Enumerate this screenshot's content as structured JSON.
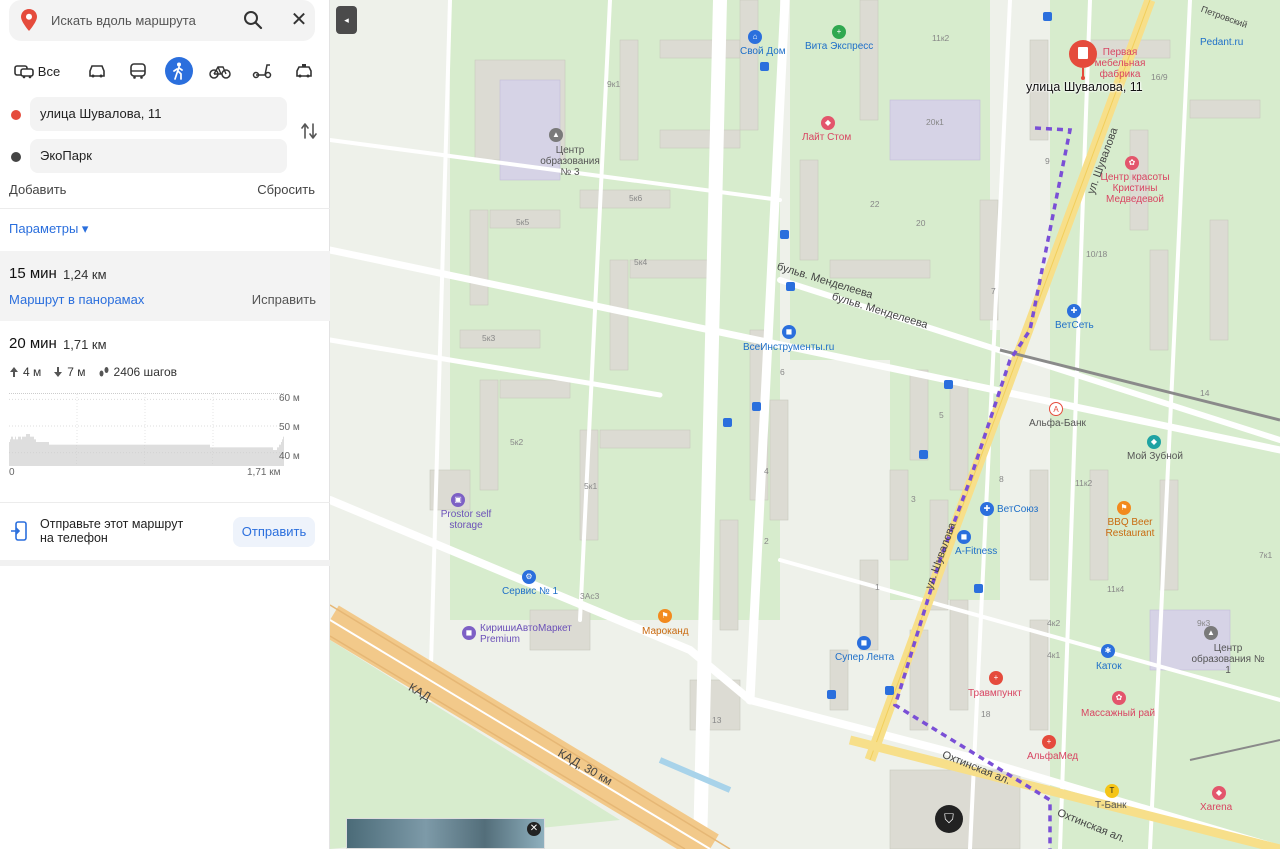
{
  "search": {
    "placeholder": "Искать вдоль маршрута"
  },
  "modes": {
    "all_label": "Все"
  },
  "route_points": [
    {
      "label": "улица Шувалова, 11",
      "color": "#e54b3c"
    },
    {
      "label": "ЭкоПарк",
      "color": "#444444"
    }
  ],
  "actions": {
    "add": "Добавить",
    "reset": "Сбросить",
    "params": "Параметры ▾"
  },
  "routes": [
    {
      "time": "15 мин",
      "distance": "1,24 км",
      "panorama_link": "Маршрут в панорамах",
      "fix_link": "Исправить"
    },
    {
      "time": "20 мин",
      "distance": "1,71 км",
      "ascent": "4 м",
      "descent": "7 м",
      "steps": "2406 шагов"
    }
  ],
  "elevation_chart": {
    "type": "bar",
    "y_ticks": [
      "60 м",
      "50 м",
      "40 м"
    ],
    "x_start": "0",
    "x_end": "1,71 км",
    "ylim": [
      35,
      62
    ],
    "values": [
      44,
      45,
      46,
      46,
      45,
      45,
      46,
      45,
      45,
      46,
      46,
      46,
      45,
      46,
      46,
      46,
      46,
      47,
      47,
      47,
      47,
      46,
      46,
      46,
      46,
      45,
      45,
      44,
      44,
      44,
      44,
      44,
      44,
      44,
      44,
      44,
      44,
      44,
      44,
      44,
      43,
      43,
      43,
      43,
      43,
      43,
      43,
      43,
      43,
      43,
      43,
      43,
      43,
      43,
      43,
      43,
      43,
      43,
      43,
      43,
      43,
      43,
      43,
      43,
      43,
      43,
      43,
      43,
      43,
      43,
      43,
      43,
      43,
      43,
      43,
      43,
      43,
      43,
      43,
      43,
      43,
      43,
      43,
      43,
      43,
      43,
      43,
      43,
      43,
      43,
      43,
      43,
      43,
      43,
      43,
      43,
      43,
      43,
      43,
      43,
      43,
      43,
      43,
      43,
      43,
      43,
      43,
      43,
      43,
      43,
      43,
      43,
      43,
      43,
      43,
      43,
      43,
      43,
      43,
      43,
      43,
      43,
      43,
      43,
      43,
      43,
      43,
      43,
      43,
      43,
      43,
      43,
      43,
      43,
      43,
      43,
      43,
      43,
      43,
      43,
      43,
      43,
      43,
      43,
      43,
      43,
      43,
      43,
      43,
      43,
      43,
      43,
      43,
      43,
      43,
      43,
      43,
      43,
      43,
      43,
      43,
      43,
      43,
      43,
      43,
      43,
      43,
      43,
      43,
      43,
      43,
      43,
      43,
      43,
      43,
      43,
      43,
      43,
      43,
      43,
      43,
      43,
      43,
      43,
      43,
      43,
      43,
      43,
      43,
      43,
      43,
      43,
      43,
      43,
      43,
      43,
      43,
      43,
      43,
      43,
      43,
      42,
      42,
      42,
      42,
      42,
      42,
      42,
      42,
      42,
      42,
      42,
      42,
      42,
      42,
      42,
      42,
      42,
      42,
      42,
      42,
      42,
      42,
      42,
      42,
      42,
      42,
      42,
      42,
      42,
      42,
      42,
      42,
      42,
      42,
      42,
      42,
      42,
      42,
      42,
      42,
      42,
      42,
      42,
      42,
      42,
      42,
      42,
      42,
      42,
      42,
      42,
      42,
      42,
      42,
      42,
      42,
      42,
      42,
      42,
      42,
      42,
      42,
      42,
      41,
      41,
      41,
      41,
      42,
      42,
      43,
      43,
      44,
      45,
      46
    ]
  },
  "send": {
    "text_line1": "Отправьте этот маршрут",
    "text_line2": "на телефон",
    "button": "Отправить"
  },
  "map": {
    "destination": "улица Шувалова, 11",
    "pois": [
      {
        "name": "Свой Дом",
        "color": "#2b6fdd"
      },
      {
        "name": "Вита Экспресс",
        "color": "#2fa84f"
      },
      {
        "name": "Центр образования № 3",
        "color": "#7a7a7a"
      },
      {
        "name": "Лайт Стом",
        "color": "#e3556c"
      },
      {
        "name": "Pedant.ru",
        "color": "#2b6fdd"
      },
      {
        "name": "Первая мебельная фабрика",
        "color": "#e54b3c"
      },
      {
        "name": "Центр красоты Кристины Медведевой",
        "color": "#e3556c"
      },
      {
        "name": "ВетСеть",
        "color": "#2b6fdd"
      },
      {
        "name": "ВсеИнструменты.ru",
        "color": "#2b6fdd"
      },
      {
        "name": "Альфа-Банк",
        "color": "#e54b3c"
      },
      {
        "name": "Мой Зубной",
        "color": "#1fa3a3"
      },
      {
        "name": "ВетСоюз",
        "color": "#2b6fdd"
      },
      {
        "name": "BBQ Beer Restaurant",
        "color": "#f28a1e"
      },
      {
        "name": "A-Fitness",
        "color": "#2b6fdd"
      },
      {
        "name": "Prostor self storage",
        "color": "#7d5fc5"
      },
      {
        "name": "Сервис № 1",
        "color": "#2b6fdd"
      },
      {
        "name": "КиришиАвтоМаркет Premium",
        "color": "#7d5fc5"
      },
      {
        "name": "Мароканд",
        "color": "#f28a1e"
      },
      {
        "name": "Супер Лента",
        "color": "#2b6fdd"
      },
      {
        "name": "Каток",
        "color": "#2b6fdd"
      },
      {
        "name": "Центр образования № 1",
        "color": "#7a7a7a"
      },
      {
        "name": "Травмпункт",
        "color": "#e54b3c"
      },
      {
        "name": "Массажный рай",
        "color": "#e3556c"
      },
      {
        "name": "АльфаМед",
        "color": "#e54b3c"
      },
      {
        "name": "Т-Банк",
        "color": "#f5c518"
      },
      {
        "name": "Xarena",
        "color": "#e3556c"
      }
    ],
    "streets": [
      "ул. Шувалова",
      "бульв. Менделеева",
      "бульв. Менделеева",
      "КАД",
      "КАД, 30 км",
      "Охтинская ал.",
      "Охтинская ал.",
      "Петровский"
    ],
    "house_numbers": [
      "5к6",
      "5к5",
      "5к4",
      "5к3",
      "5к2",
      "5к1",
      "3Ас3",
      "9к1",
      "20к1",
      "22",
      "20",
      "10/18",
      "16/9",
      "11к2",
      "8",
      "6",
      "4",
      "2",
      "1",
      "3",
      "5",
      "7",
      "9",
      "13",
      "14",
      "18",
      "4к2",
      "4к1",
      "7к1",
      "9к3",
      "11к4",
      "11к2"
    ]
  }
}
